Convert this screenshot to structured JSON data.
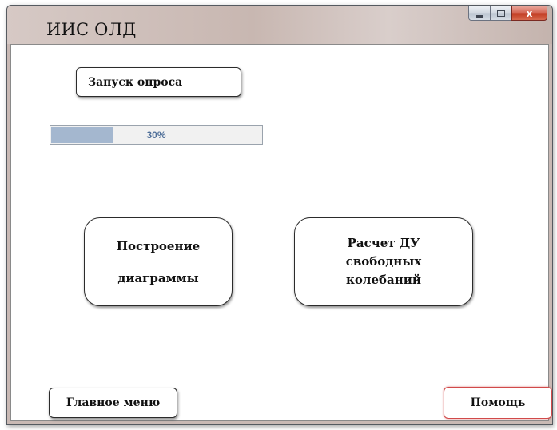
{
  "window": {
    "title": "ИИС ОЛД",
    "close_glyph": "x"
  },
  "survey": {
    "start_label": "Запуск опроса",
    "progress_percent": 30,
    "progress_text": "30%"
  },
  "actions": {
    "diagram_line1": "Построение",
    "diagram_line2": "диаграммы",
    "calc_line1": "Расчет ДУ",
    "calc_line2": "свободных",
    "calc_line3": "колебаний"
  },
  "footer": {
    "main_menu_label": "Главное меню",
    "help_label": "Помощь"
  },
  "colors": {
    "progress_fill": "#a4b7cf",
    "progress_text": "#4f6f99",
    "help_border": "#d14a4a",
    "close_button": "#c0391f"
  }
}
